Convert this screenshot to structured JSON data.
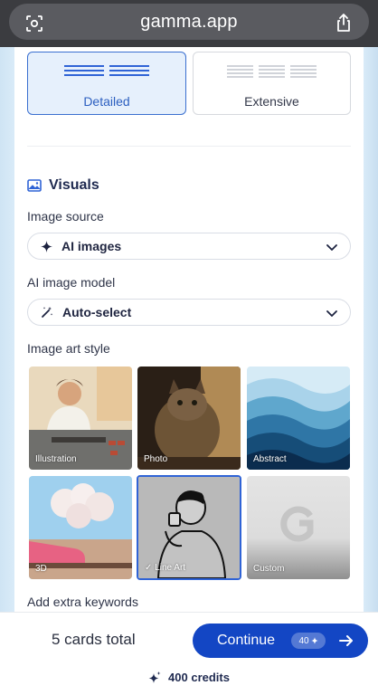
{
  "browser": {
    "url": "gamma.app",
    "left_icon": "lens-icon",
    "right_icon": "share-icon"
  },
  "detail_options": [
    {
      "label": "Detailed",
      "selected": true
    },
    {
      "label": "Extensive",
      "selected": false
    }
  ],
  "visuals": {
    "title": "Visuals",
    "image_source_label": "Image source",
    "image_source_value": "AI images",
    "image_model_label": "AI image model",
    "image_model_value": "Auto-select",
    "art_style_label": "Image art style",
    "styles": [
      {
        "label": "Illustration"
      },
      {
        "label": "Photo"
      },
      {
        "label": "Abstract"
      },
      {
        "label": "3D"
      },
      {
        "label": "✓ Line Art",
        "selected": true
      },
      {
        "label": "Custom"
      }
    ],
    "extra_keywords_label": "Add extra keywords"
  },
  "footer": {
    "cards_total": "5 cards total",
    "continue_label": "Continue",
    "continue_cost": "40",
    "credits": "400 credits"
  },
  "colors": {
    "accent": "#1346c4",
    "selected_border": "#3a6fd0",
    "selected_bg": "#e6f0fc"
  }
}
